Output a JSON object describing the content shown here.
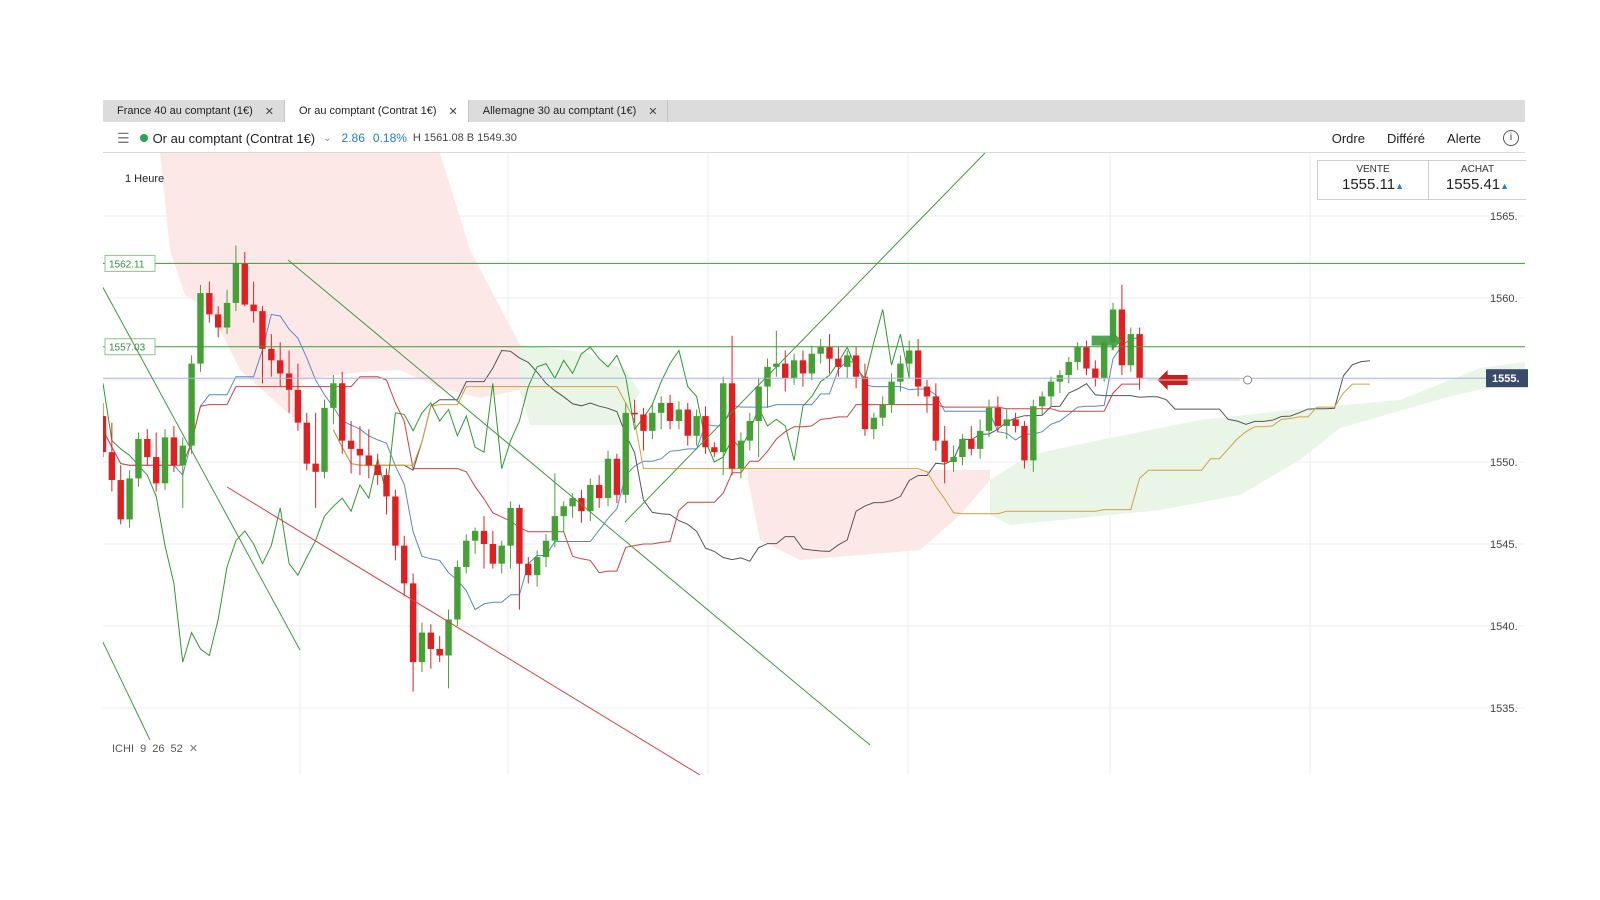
{
  "tabs": [
    {
      "label": "France 40 au comptant (1€)",
      "active": false
    },
    {
      "label": "Or au comptant (Contrat 1€)",
      "active": true
    },
    {
      "label": "Allemagne 30 au comptant (1€)",
      "active": false
    }
  ],
  "toolbar": {
    "instrument": "Or au comptant (Contrat 1€)",
    "change": "2.86",
    "change_pct": "0.18%",
    "high_low": "H 1561.08 B 1549.30",
    "buttons": [
      "Ordre",
      "Différé",
      "Alerte"
    ]
  },
  "timeframe": "1 Heure",
  "price_boxes": {
    "sell_label": "VENTE",
    "sell_value": "1555.11",
    "buy_label": "ACHAT",
    "buy_value": "1555.41"
  },
  "indicator": {
    "name": "ICHI",
    "params": "9 26 52"
  },
  "colors": {
    "up": "#45a035",
    "down": "#e02020",
    "tenkan": "#5b86c9",
    "kijun": "#d24040",
    "senkou_a": "#555555",
    "senkou_b": "#d4a040",
    "chikou": "#2f9a2f",
    "bearish_cloud": "#fde8e8",
    "bullish_cloud": "#e9f5e6"
  },
  "chart_data": {
    "type": "candlestick",
    "y_ticks": [
      "1565.",
      "1560.",
      "1555.",
      "1550.",
      "1545.",
      "1540.",
      "1535."
    ],
    "ylim": [
      1533,
      1568
    ],
    "level_lines": [
      {
        "label": "1562.11",
        "value": 1562.11,
        "color": "#3a9a3a"
      },
      {
        "label": "1557.03",
        "value": 1557.03,
        "color": "#3a9a3a"
      }
    ],
    "current_price": {
      "label": "1555.",
      "value": 1555.11
    },
    "candles_ohlc": [
      [
        1552.8,
        1553.6,
        1550.3,
        1550.6
      ],
      [
        1550.6,
        1552.4,
        1548.2,
        1548.9
      ],
      [
        1548.9,
        1549.8,
        1546.2,
        1546.5
      ],
      [
        1546.5,
        1549.5,
        1546.0,
        1549.0
      ],
      [
        1549.0,
        1551.8,
        1548.5,
        1551.4
      ],
      [
        1551.4,
        1552.0,
        1549.8,
        1550.3
      ],
      [
        1550.3,
        1551.8,
        1548.2,
        1548.7
      ],
      [
        1548.7,
        1552.0,
        1548.3,
        1551.5
      ],
      [
        1551.5,
        1552.2,
        1549.4,
        1549.8
      ],
      [
        1549.8,
        1551.5,
        1547.2,
        1551.0
      ],
      [
        1551.0,
        1556.5,
        1550.5,
        1556.0
      ],
      [
        1556.0,
        1560.8,
        1555.5,
        1560.3
      ],
      [
        1560.3,
        1561.0,
        1558.5,
        1559.0
      ],
      [
        1559.0,
        1559.5,
        1557.6,
        1558.2
      ],
      [
        1558.2,
        1560.5,
        1557.8,
        1559.7
      ],
      [
        1559.7,
        1563.2,
        1559.2,
        1562.1
      ],
      [
        1562.1,
        1562.8,
        1559.5,
        1559.6
      ],
      [
        1559.6,
        1561.0,
        1558.5,
        1559.2
      ],
      [
        1559.2,
        1559.5,
        1554.8,
        1556.9
      ],
      [
        1556.9,
        1557.8,
        1555.2,
        1556.2
      ],
      [
        1556.2,
        1557.3,
        1554.6,
        1555.4
      ],
      [
        1555.4,
        1556.8,
        1553.0,
        1554.4
      ],
      [
        1554.4,
        1556.0,
        1551.9,
        1552.4
      ],
      [
        1552.4,
        1553.0,
        1549.5,
        1549.9
      ],
      [
        1549.9,
        1553.0,
        1547.2,
        1549.4
      ],
      [
        1549.4,
        1553.8,
        1549.0,
        1553.3
      ],
      [
        1553.3,
        1555.3,
        1552.3,
        1554.8
      ],
      [
        1554.8,
        1555.5,
        1550.5,
        1551.3
      ],
      [
        1551.3,
        1552.5,
        1549.3,
        1550.8
      ],
      [
        1550.8,
        1552.2,
        1549.2,
        1550.4
      ],
      [
        1550.4,
        1552.0,
        1549.0,
        1549.8
      ],
      [
        1549.8,
        1550.5,
        1548.6,
        1549.2
      ],
      [
        1549.2,
        1549.6,
        1546.8,
        1547.9
      ],
      [
        1547.9,
        1548.3,
        1544.0,
        1544.9
      ],
      [
        1544.9,
        1545.5,
        1541.8,
        1542.6
      ],
      [
        1542.6,
        1543.2,
        1536.0,
        1537.8
      ],
      [
        1537.8,
        1540.2,
        1537.2,
        1539.6
      ],
      [
        1539.6,
        1540.1,
        1537.4,
        1538.6
      ],
      [
        1538.6,
        1539.4,
        1537.8,
        1538.2
      ],
      [
        1538.2,
        1541.0,
        1536.2,
        1540.4
      ],
      [
        1540.4,
        1544.0,
        1540.0,
        1543.6
      ],
      [
        1543.6,
        1545.6,
        1543.2,
        1545.2
      ],
      [
        1545.2,
        1546.0,
        1544.4,
        1545.8
      ],
      [
        1545.8,
        1546.7,
        1543.5,
        1545.0
      ],
      [
        1545.0,
        1545.8,
        1543.5,
        1543.8
      ],
      [
        1543.8,
        1545.2,
        1543.2,
        1544.9
      ],
      [
        1544.9,
        1547.6,
        1543.5,
        1547.2
      ],
      [
        1547.2,
        1547.4,
        1541.0,
        1543.8
      ],
      [
        1543.8,
        1544.2,
        1542.6,
        1543.1
      ],
      [
        1543.1,
        1544.6,
        1542.4,
        1544.2
      ],
      [
        1544.2,
        1545.6,
        1543.6,
        1545.2
      ],
      [
        1545.2,
        1549.3,
        1544.8,
        1546.7
      ],
      [
        1546.7,
        1547.6,
        1545.7,
        1547.3
      ],
      [
        1547.3,
        1548.1,
        1546.6,
        1547.8
      ],
      [
        1547.8,
        1548.3,
        1546.3,
        1547.0
      ],
      [
        1547.0,
        1549.0,
        1546.4,
        1548.6
      ],
      [
        1548.6,
        1549.2,
        1547.2,
        1547.8
      ],
      [
        1547.8,
        1550.7,
        1547.3,
        1550.2
      ],
      [
        1550.2,
        1550.5,
        1547.5,
        1548.0
      ],
      [
        1548.0,
        1553.6,
        1547.5,
        1553.0
      ],
      [
        1553.0,
        1553.8,
        1552.4,
        1552.9
      ],
      [
        1552.9,
        1553.3,
        1550.7,
        1551.9
      ],
      [
        1551.9,
        1553.5,
        1551.4,
        1553.0
      ],
      [
        1553.0,
        1554.0,
        1552.0,
        1553.6
      ],
      [
        1553.6,
        1554.1,
        1552.0,
        1552.5
      ],
      [
        1552.5,
        1553.7,
        1552.0,
        1553.2
      ],
      [
        1553.2,
        1553.6,
        1551.0,
        1551.6
      ],
      [
        1551.6,
        1553.2,
        1551.0,
        1552.8
      ],
      [
        1552.8,
        1553.4,
        1550.5,
        1550.9
      ],
      [
        1550.9,
        1551.2,
        1550.3,
        1550.6
      ],
      [
        1550.6,
        1555.2,
        1549.2,
        1554.8
      ],
      [
        1554.8,
        1557.7,
        1549.2,
        1549.6
      ],
      [
        1549.6,
        1551.8,
        1549.0,
        1551.3
      ],
      [
        1551.3,
        1553.0,
        1550.7,
        1552.5
      ],
      [
        1552.5,
        1555.1,
        1550.3,
        1554.6
      ],
      [
        1554.6,
        1556.3,
        1553.3,
        1555.8
      ],
      [
        1555.8,
        1558.0,
        1555.2,
        1556.0
      ],
      [
        1556.0,
        1556.8,
        1554.3,
        1555.1
      ],
      [
        1555.1,
        1556.6,
        1554.7,
        1556.2
      ],
      [
        1556.2,
        1556.8,
        1554.6,
        1555.4
      ],
      [
        1555.4,
        1557.1,
        1555.0,
        1556.6
      ],
      [
        1556.6,
        1557.5,
        1556.0,
        1557.0
      ],
      [
        1557.0,
        1557.8,
        1555.4,
        1556.3
      ],
      [
        1556.3,
        1557.0,
        1555.2,
        1555.8
      ],
      [
        1555.8,
        1556.8,
        1555.1,
        1556.5
      ],
      [
        1556.5,
        1557.0,
        1554.5,
        1555.2
      ],
      [
        1555.2,
        1556.0,
        1551.6,
        1552.0
      ],
      [
        1552.0,
        1553.0,
        1551.4,
        1552.7
      ],
      [
        1552.7,
        1554.0,
        1552.2,
        1553.5
      ],
      [
        1553.5,
        1555.4,
        1553.0,
        1554.9
      ],
      [
        1554.9,
        1556.5,
        1554.3,
        1556.0
      ],
      [
        1556.0,
        1557.4,
        1555.2,
        1556.8
      ],
      [
        1556.8,
        1557.5,
        1554.0,
        1554.6
      ],
      [
        1554.6,
        1555.0,
        1553.0,
        1554.0
      ],
      [
        1554.0,
        1554.8,
        1550.7,
        1551.3
      ],
      [
        1551.3,
        1552.2,
        1548.7,
        1550.0
      ],
      [
        1550.0,
        1551.0,
        1549.4,
        1550.3
      ],
      [
        1550.3,
        1551.7,
        1549.8,
        1551.4
      ],
      [
        1551.4,
        1552.2,
        1550.4,
        1550.8
      ],
      [
        1550.8,
        1552.6,
        1550.2,
        1551.9
      ],
      [
        1551.9,
        1553.8,
        1551.5,
        1553.3
      ],
      [
        1553.3,
        1554.0,
        1551.8,
        1552.2
      ],
      [
        1552.2,
        1553.2,
        1551.4,
        1552.6
      ],
      [
        1552.6,
        1553.0,
        1551.8,
        1552.2
      ],
      [
        1552.2,
        1552.5,
        1549.6,
        1550.1
      ],
      [
        1550.1,
        1553.8,
        1549.4,
        1553.4
      ],
      [
        1553.4,
        1554.3,
        1552.9,
        1554.0
      ],
      [
        1554.0,
        1555.2,
        1553.4,
        1554.9
      ],
      [
        1554.9,
        1555.6,
        1554.2,
        1555.3
      ],
      [
        1555.3,
        1556.4,
        1554.8,
        1556.1
      ],
      [
        1556.1,
        1557.3,
        1555.6,
        1557.0
      ],
      [
        1557.0,
        1557.4,
        1555.3,
        1555.7
      ],
      [
        1555.7,
        1556.2,
        1554.6,
        1555.1
      ],
      [
        1555.1,
        1557.5,
        1554.9,
        1557.3
      ],
      [
        1557.3,
        1559.7,
        1556.8,
        1559.3
      ],
      [
        1559.3,
        1560.8,
        1555.3,
        1555.9
      ],
      [
        1555.9,
        1558.2,
        1555.5,
        1557.8
      ],
      [
        1557.8,
        1558.2,
        1554.4,
        1555.1
      ]
    ]
  }
}
